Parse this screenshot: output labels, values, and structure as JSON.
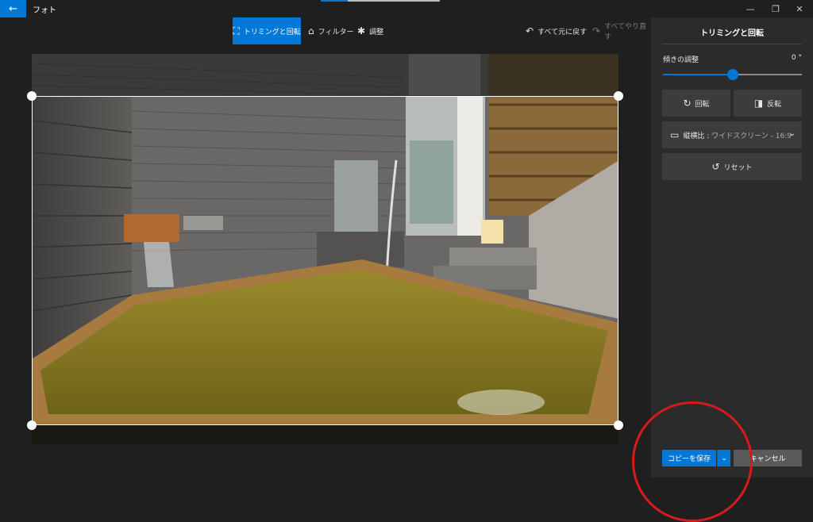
{
  "window": {
    "title": "フォト",
    "back_icon": "←",
    "minimize_icon": "—",
    "restore_icon": "❐",
    "close_icon": "✕"
  },
  "toolbar": {
    "crop_rotate_label": "トリミングと回転",
    "crop_icon": "⛶",
    "filter_label": "フィルター",
    "filter_icon": "⌂",
    "adjust_label": "調整",
    "adjust_icon": "✱",
    "undo_all_label": "すべて元に戻す",
    "undo_icon": "↶",
    "redo_all_label": "すべてやり直す",
    "redo_icon": "↷"
  },
  "panel": {
    "title": "トリミングと回転",
    "tilt_label": "傾きの調整",
    "tilt_value": "0 °",
    "tilt_slider_level": 0.5,
    "rotate_label": "回転",
    "rotate_icon": "↻",
    "flip_label": "反転",
    "flip_icon": "◨",
    "aspect_label": "縦横比 :",
    "aspect_value": "ワイドスクリーン - 16:9",
    "aspect_icon": "▭",
    "chevron_icon": "⌄",
    "reset_label": "リセット",
    "reset_icon": "↺",
    "save_copy_label": "コピーを保存",
    "save_dropdown_icon": "⌄",
    "cancel_label": "キャンセル"
  },
  "colors": {
    "accent": "#0078d7",
    "annotation": "#d81a1a",
    "panel_bg": "#2b2b2b"
  }
}
